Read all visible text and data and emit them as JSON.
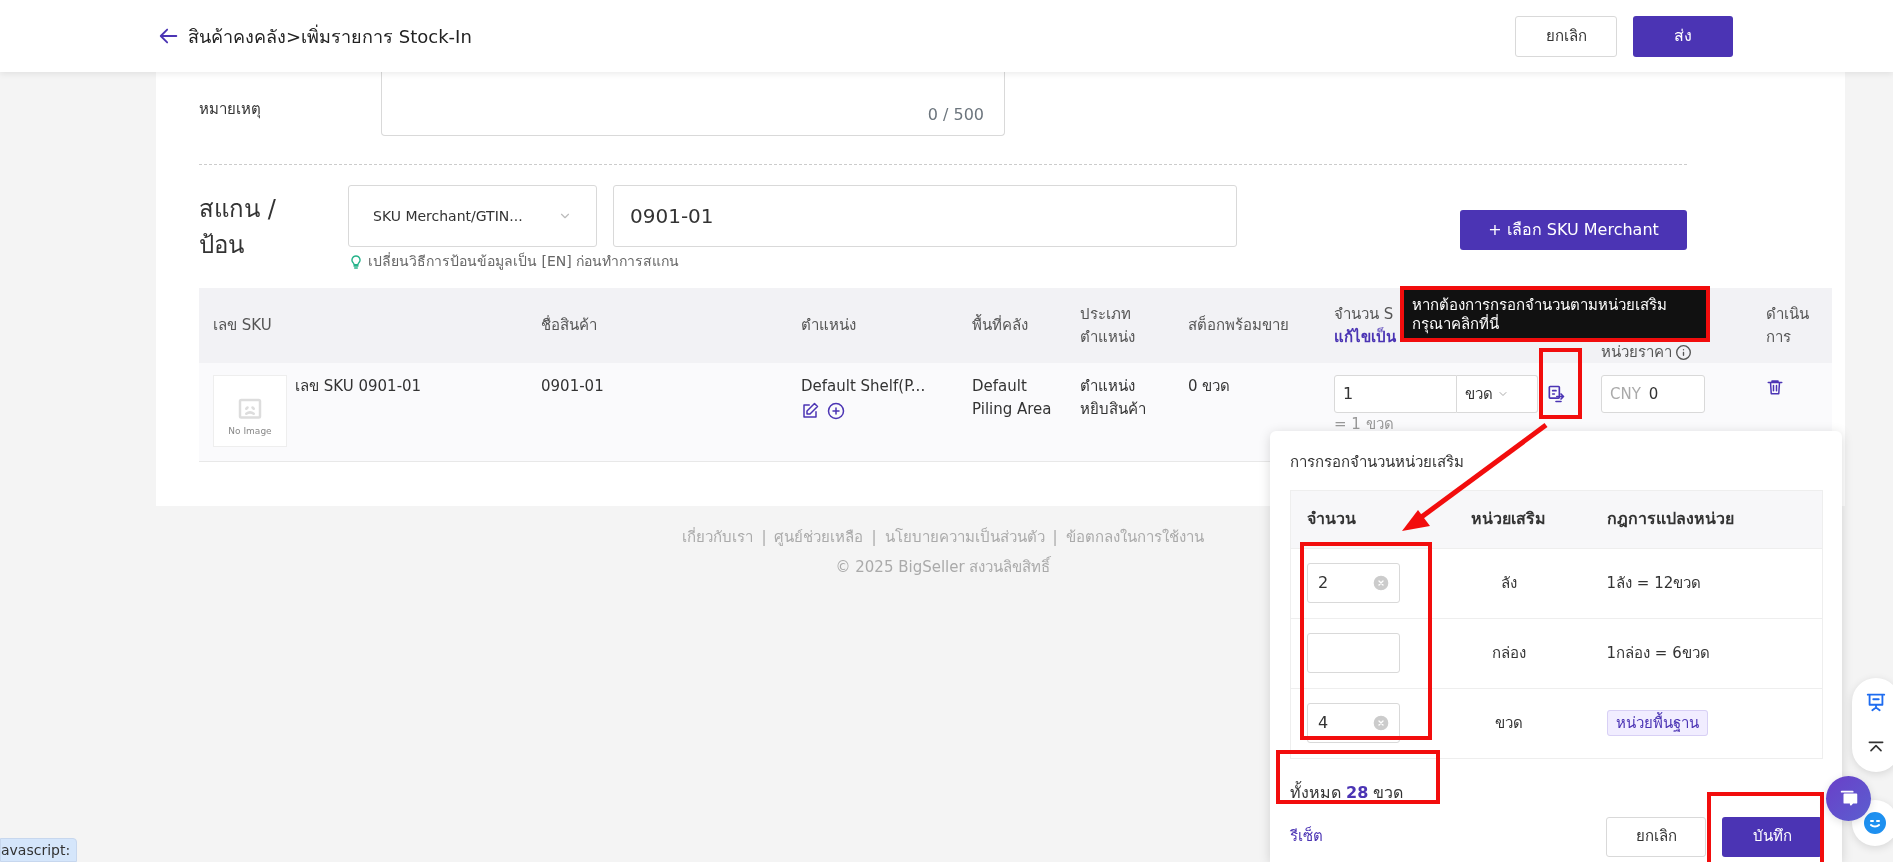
{
  "header": {
    "title": "สินค้าคงคลัง>เพิ่มรายการ Stock-In",
    "cancel": "ยกเลิก",
    "submit": "ส่ง"
  },
  "remark": {
    "label": "หมายเหตุ",
    "counter": "0 / 500"
  },
  "scan": {
    "label": "สแกน / ป้อน",
    "mode": "SKU Merchant/GTIN...",
    "value": "0901-01",
    "hint": "เปลี่ยนวิธีการป้อนข้อมูลเป็น [EN] ก่อนทำการสแกน",
    "add_button": "+ เลือก SKU Merchant"
  },
  "table": {
    "columns": [
      {
        "label": "เลข SKU"
      },
      {
        "label": "ชื่อสินค้า"
      },
      {
        "label": "ตำแหน่ง"
      },
      {
        "label": "พื้นที่คลัง"
      },
      {
        "label": "ประเภท ตำแหน่ง"
      },
      {
        "label": "สต็อกพร้อมขาย"
      },
      {
        "label": "จำนวน S",
        "sub": "แก้ไขเป็น"
      },
      {
        "label": "หน่วยราคา",
        "info": true
      },
      {
        "label": "ดำเนินการ"
      }
    ],
    "rows": [
      {
        "image_label": "No Image",
        "sku": "เลข SKU 0901-01",
        "name": "0901-01",
        "location": "Default Shelf(P...",
        "zone": "Default Piling Area",
        "location_type": "ตำแหน่ง หยิบสินค้า",
        "stock": "0 ขวด",
        "qty": "1",
        "unit": "ขวด",
        "qty_note": "= 1 ขวด",
        "currency": "CNY",
        "price": "0"
      }
    ]
  },
  "tooltip": {
    "text": "หากต้องการกรอกจำนวนตามหน่วยเสริม\nกรุณาคลิกที่นี่"
  },
  "popup": {
    "title": "การกรอกจำนวนหน่วยเสริม",
    "columns": [
      "จำนวน",
      "หน่วยเสริม",
      "กฎการแปลงหน่วย"
    ],
    "rows": [
      {
        "value": "2",
        "unit": "ลัง",
        "rule": "1ลัง = 12ขวด",
        "kind": "rule"
      },
      {
        "unit": "กล่อง",
        "rule": "1กล่อง = 6ขวด",
        "kind": "rule"
      },
      {
        "value": "4",
        "unit": "ขวด",
        "rule": "หน่วยพื้นฐาน",
        "kind": "base"
      }
    ],
    "total": "ทั้งหมด **28** ขวด",
    "reset": "รีเซ็ต",
    "cancel": "ยกเลิก",
    "save": "บันทึก"
  },
  "footer": {
    "separator": "|",
    "links": [
      "เกี่ยวกับเรา",
      "ศูนย์ช่วยเหลือ",
      "นโยบายความเป็นส่วนตัว",
      "ข้อตกลงในการใช้งาน"
    ],
    "copyright": "© 2025 BigSeller สงวนลิขสิทธิ์"
  },
  "status_bar": {
    "text": "avascript:"
  }
}
